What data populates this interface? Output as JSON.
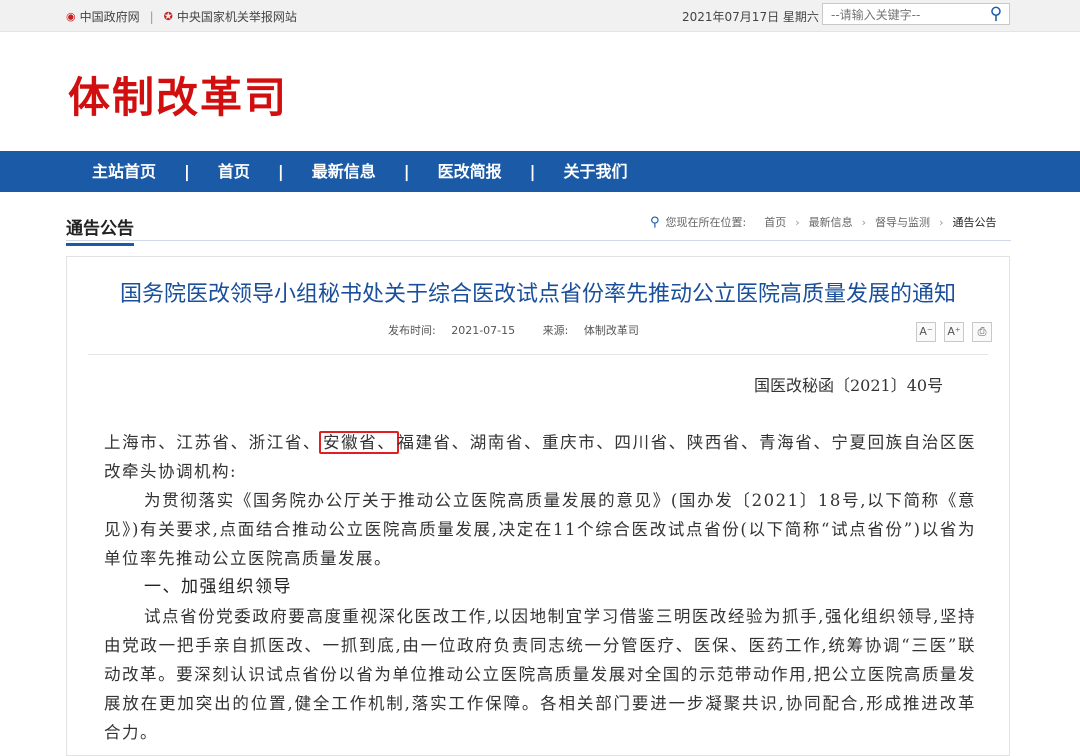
{
  "topbar": {
    "link1": "中国政府网",
    "separator": "|",
    "link2": "中央国家机关举报网站",
    "date": "2021年07月17日 星期六",
    "search_placeholder": "--请输入关键字--"
  },
  "header": {
    "logo": "体制改革司"
  },
  "nav": {
    "items": [
      "主站首页",
      "首页",
      "最新信息",
      "医改简报",
      "关于我们"
    ],
    "separator": "|"
  },
  "section": {
    "title": "通告公告",
    "crumb_prefix": "您现在所在位置:",
    "crumbs": [
      "首页",
      "最新信息",
      "督导与监测",
      "通告公告"
    ]
  },
  "article": {
    "title": "国务院医改领导小组秘书处关于综合医改试点省份率先推动公立医院高质量发展的通知",
    "published_label": "发布时间:",
    "published": "2021-07-15",
    "source_label": "来源:",
    "source": "体制改革司",
    "tools": [
      "A⁻",
      "A⁺",
      "⎙"
    ],
    "doc_number": "国医改秘函〔2021〕40号",
    "recipients_before": "上海市、江苏省、浙江省、",
    "recipients_highlight": "安徽省、",
    "recipients_after": "福建省、湖南省、重庆市、四川省、陕西省、青海省、宁夏回族自治区医改牵头协调机构:",
    "para1": "为贯彻落实《国务院办公厅关于推动公立医院高质量发展的意见》(国办发〔2021〕18号,以下简称《意见》)有关要求,点面结合推动公立医院高质量发展,决定在11个综合医改试点省份(以下简称“试点省份”)以省为单位率先推动公立医院高质量发展。",
    "heading1": "一、加强组织领导",
    "para2": "试点省份党委政府要高度重视深化医改工作,以因地制宜学习借鉴三明医改经验为抓手,强化组织领导,坚持由党政一把手亲自抓医改、一抓到底,由一位政府负责同志统一分管医疗、医保、医药工作,统筹协调“三医”联动改革。要深刻认识试点省份以省为单位推动公立医院高质量发展对全国的示范带动作用,把公立医院高质量发展放在更加突出的位置,健全工作机制,落实工作保障。各相关部门要进一步凝聚共识,协同配合,形成推进改革合力。"
  },
  "colors": {
    "brand_red": "#d10f0f",
    "nav_blue": "#1a5aa6",
    "title_blue": "#1a4f9c",
    "highlight": "#e02020"
  }
}
